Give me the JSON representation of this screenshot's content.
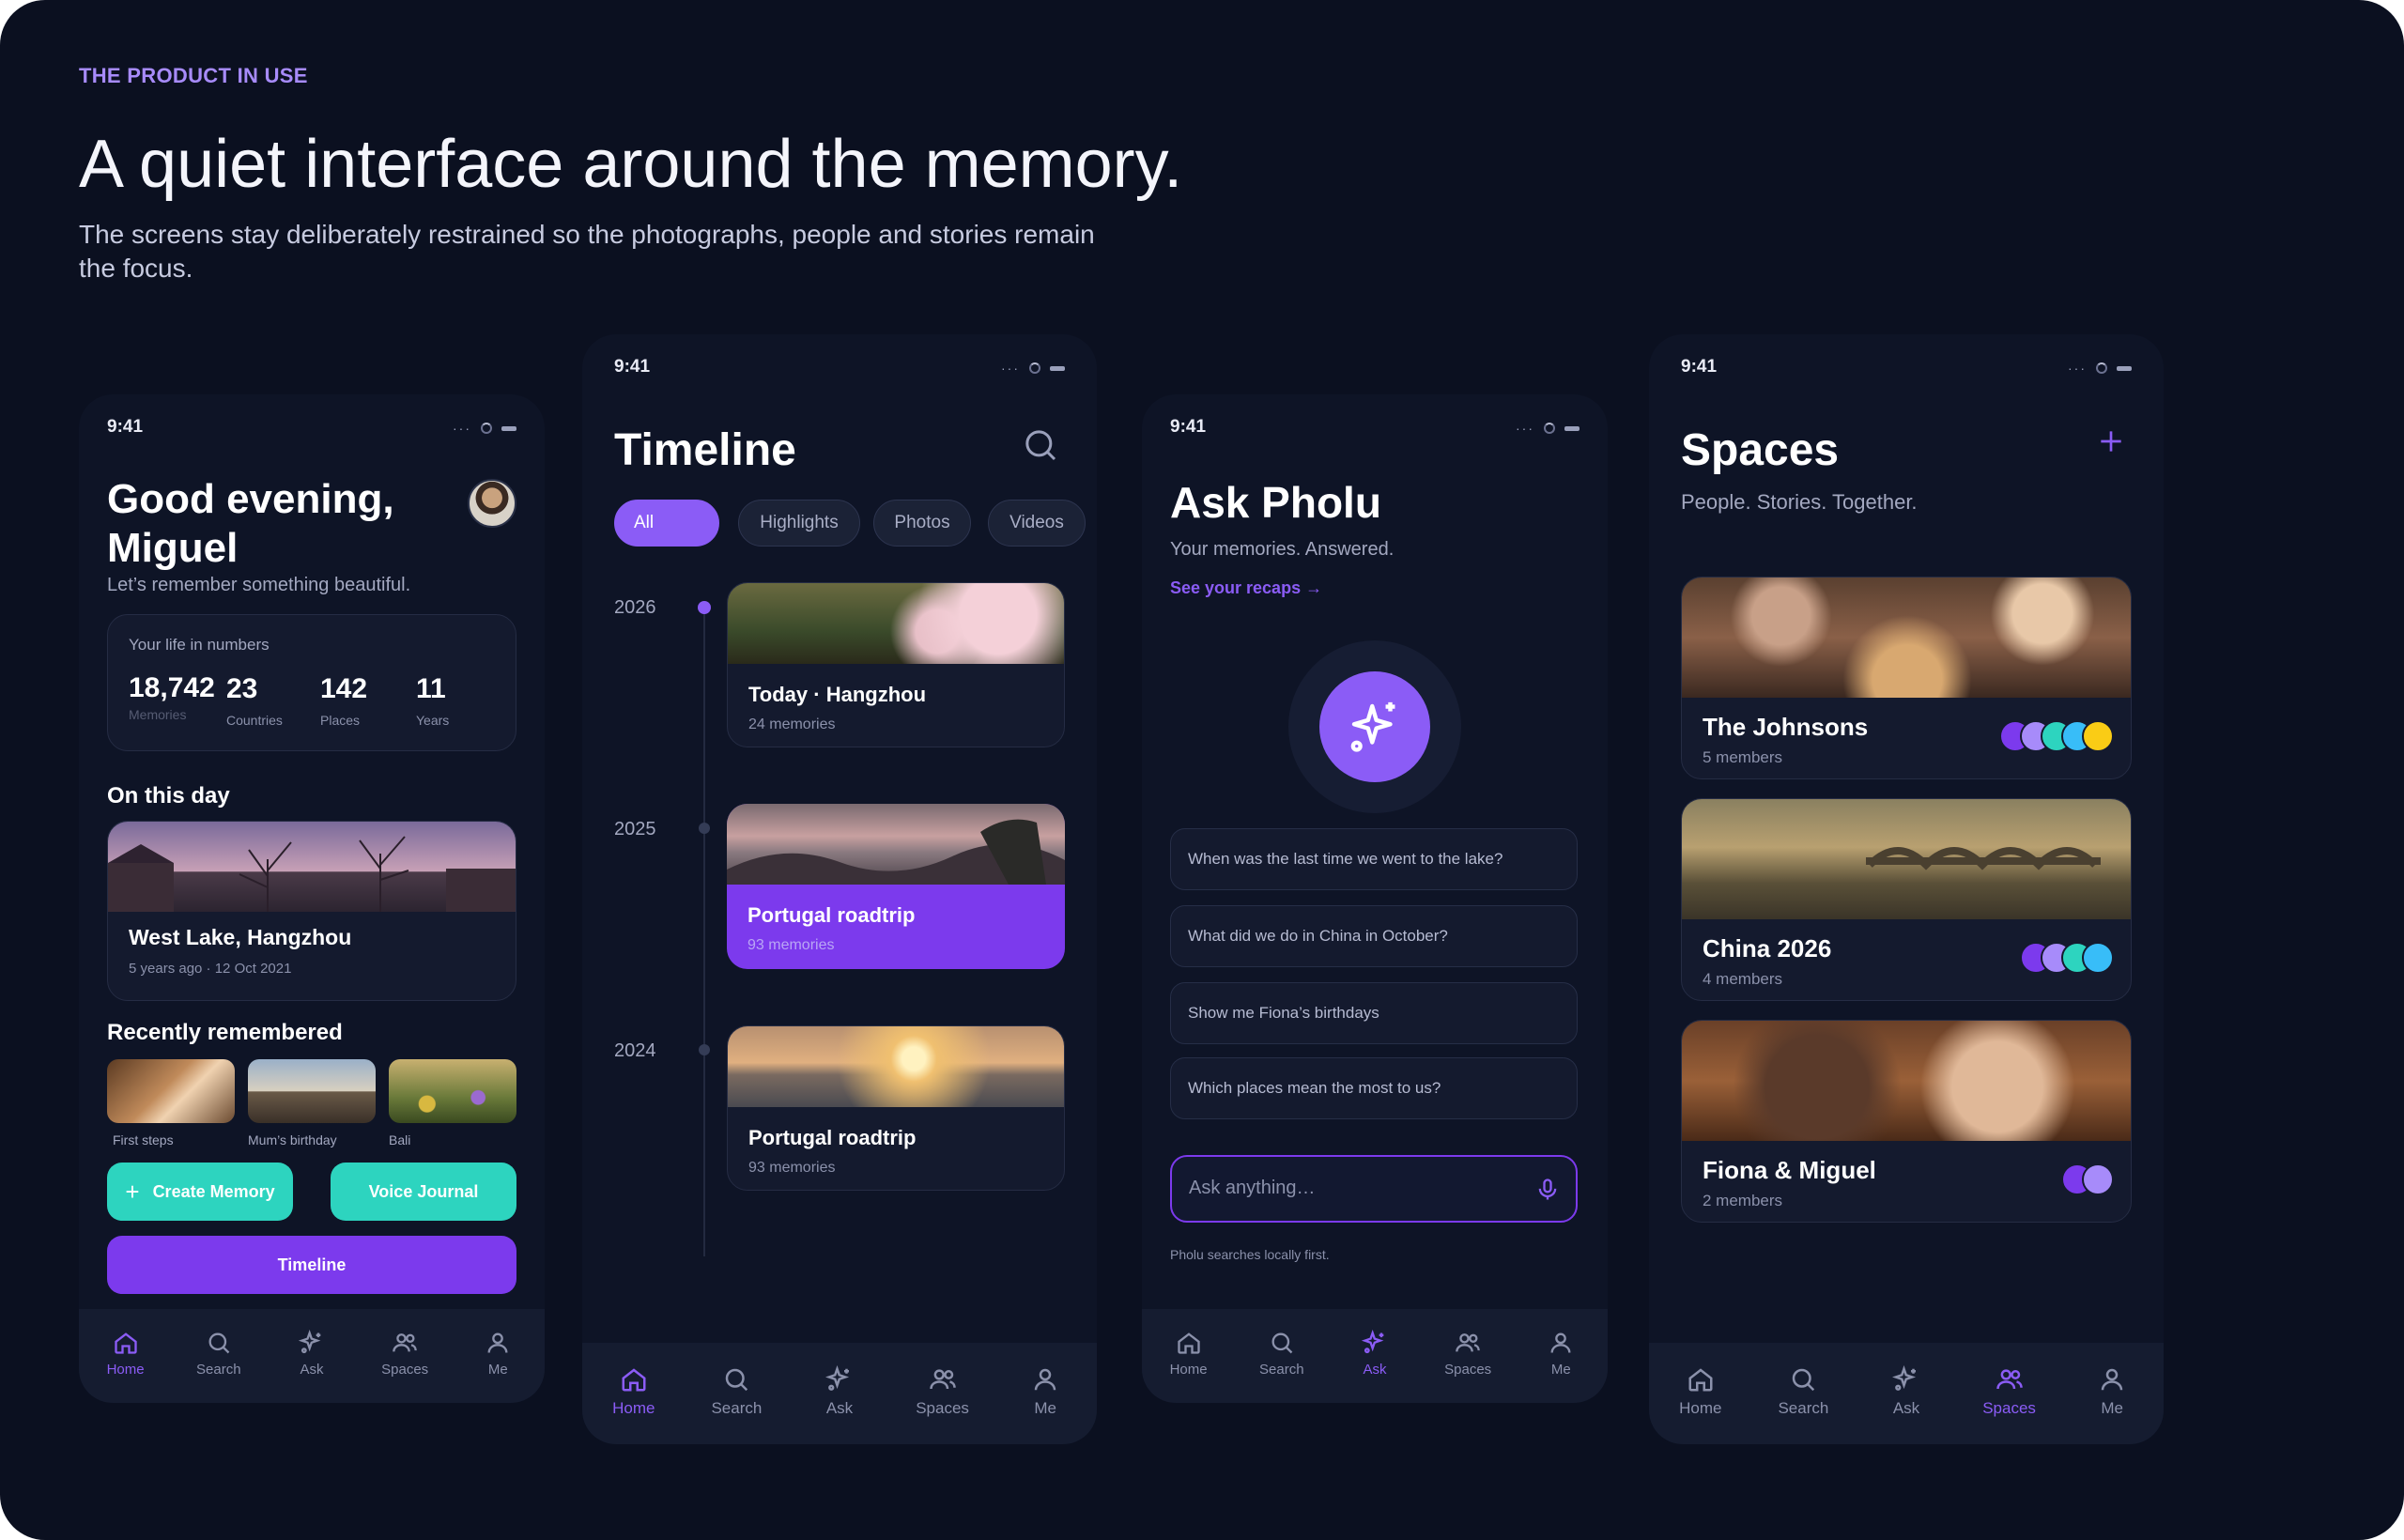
{
  "section": {
    "eyebrow": "THE PRODUCT IN USE",
    "headline": "A quiet interface around the memory.",
    "subhead": "The screens stay deliberately restrained so the photographs, people and stories remain the focus."
  },
  "status": {
    "time": "9:41"
  },
  "nav": {
    "home": "Home",
    "search": "Search",
    "ask": "Ask",
    "spaces": "Spaces",
    "me": "Me"
  },
  "colors": {
    "accent": "#8b5cf6",
    "teal": "#2dd4bf",
    "bg": "#0b1020"
  },
  "home": {
    "greeting": "Good evening, Miguel",
    "subtitle": "Let’s remember something beautiful.",
    "stats_title": "Your life in numbers",
    "stats": [
      {
        "value": "18,742",
        "label": "Memories"
      },
      {
        "value": "23",
        "label": "Countries"
      },
      {
        "value": "142",
        "label": "Places"
      },
      {
        "value": "11",
        "label": "Years"
      }
    ],
    "on_this_day_title": "On this day",
    "on_this_day_place": "West Lake, Hangzhou",
    "on_this_day_meta": "5 years ago · 12 Oct 2021",
    "recent_title": "Recently remembered",
    "recent": [
      "First steps",
      "Mum’s birthday",
      "Bali"
    ],
    "create_memory": "Create Memory",
    "voice_journal": "Voice Journal",
    "timeline_button": "Timeline"
  },
  "timeline": {
    "title": "Timeline",
    "filters": [
      "All",
      "Highlights",
      "Photos",
      "Videos"
    ],
    "entries": [
      {
        "year": "2026",
        "title": "Today · Hangzhou",
        "meta": "24 memories"
      },
      {
        "year": "2025",
        "title": "Portugal roadtrip",
        "meta": "93 memories"
      },
      {
        "year": "2024",
        "title": "Portugal roadtrip",
        "meta": "93 memories"
      }
    ]
  },
  "ask": {
    "title": "Ask Pholu",
    "subtitle": "Your memories. Answered.",
    "recaps_link": "See your recaps →",
    "suggestions": [
      "When was the last time we went to the lake?",
      "What did we do in China in October?",
      "Show me Fiona’s birthdays",
      "Which places mean the most to us?"
    ],
    "input_placeholder": "Ask anything…",
    "footnote": "Pholu searches locally first."
  },
  "spaces": {
    "title": "Spaces",
    "subtitle": "People. Stories. Together.",
    "items": [
      {
        "name": "The Johnsons",
        "members": "5 members"
      },
      {
        "name": "China 2026",
        "members": "4 members"
      },
      {
        "name": "Fiona & Miguel",
        "members": "2 members"
      }
    ]
  }
}
